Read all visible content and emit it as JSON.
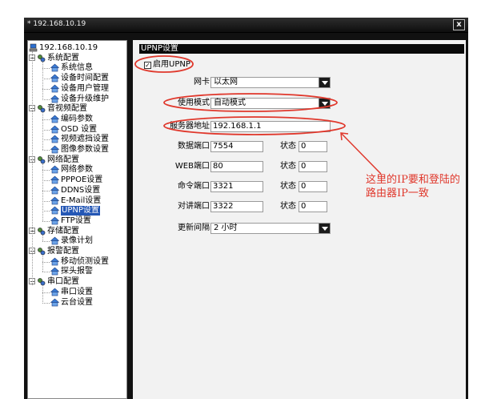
{
  "window": {
    "title": "* 192.168.10.19",
    "close_label": "x"
  },
  "tree": [
    {
      "label": "192.168.10.19",
      "level": 0,
      "icon": "computer-icon"
    },
    {
      "label": "系统配置",
      "level": 1,
      "icon": "folder-config-icon",
      "expand": "−"
    },
    {
      "label": "系统信息",
      "level": 2,
      "icon": "house-icon"
    },
    {
      "label": "设备时间配置",
      "level": 2,
      "icon": "house-icon"
    },
    {
      "label": "设备用户管理",
      "level": 2,
      "icon": "house-icon"
    },
    {
      "label": "设备升级维护",
      "level": 2,
      "icon": "house-icon"
    },
    {
      "label": "音视频配置",
      "level": 1,
      "icon": "folder-config-icon",
      "expand": "−"
    },
    {
      "label": "编码参数",
      "level": 2,
      "icon": "house-icon"
    },
    {
      "label": "OSD 设置",
      "level": 2,
      "icon": "house-icon"
    },
    {
      "label": "视频遮挡设置",
      "level": 2,
      "icon": "house-icon"
    },
    {
      "label": "图像参数设置",
      "level": 2,
      "icon": "house-icon"
    },
    {
      "label": "网络配置",
      "level": 1,
      "icon": "folder-config-icon",
      "expand": "−"
    },
    {
      "label": "网络参数",
      "level": 2,
      "icon": "house-icon"
    },
    {
      "label": "PPPOE设置",
      "level": 2,
      "icon": "house-icon"
    },
    {
      "label": "DDNS设置",
      "level": 2,
      "icon": "house-icon"
    },
    {
      "label": "E-Mail设置",
      "level": 2,
      "icon": "house-icon"
    },
    {
      "label": "UPNP设置",
      "level": 2,
      "icon": "house-icon",
      "selected": true
    },
    {
      "label": "FTP设置",
      "level": 2,
      "icon": "house-icon"
    },
    {
      "label": "存储配置",
      "level": 1,
      "icon": "folder-config-icon",
      "expand": "−"
    },
    {
      "label": "录像计划",
      "level": 2,
      "icon": "house-icon"
    },
    {
      "label": "报警配置",
      "level": 1,
      "icon": "folder-config-icon",
      "expand": "−"
    },
    {
      "label": "移动侦测设置",
      "level": 2,
      "icon": "house-icon"
    },
    {
      "label": "探头报警",
      "level": 2,
      "icon": "house-icon"
    },
    {
      "label": "串口配置",
      "level": 1,
      "icon": "folder-config-icon",
      "expand": "−"
    },
    {
      "label": "串口设置",
      "level": 2,
      "icon": "house-icon"
    },
    {
      "label": "云台设置",
      "level": 2,
      "icon": "house-icon"
    }
  ],
  "panel": {
    "title": "UPNP设置",
    "enable_checkbox": {
      "label": "启用UPNP",
      "checked": true,
      "mark": "✓"
    },
    "nic": {
      "label": "网卡",
      "value": "以太网"
    },
    "mode": {
      "label": "使用模式",
      "value": "自动模式"
    },
    "server": {
      "label": "服务器地址",
      "value": "192.168.1.1"
    },
    "status_label": "状态",
    "ports": [
      {
        "label": "数据端口",
        "value": "7554",
        "status": "0"
      },
      {
        "label": "WEB端口",
        "value": "80",
        "status": "0"
      },
      {
        "label": "命令端口",
        "value": "3321",
        "status": "0"
      },
      {
        "label": "对讲端口",
        "value": "3322",
        "status": "0"
      }
    ],
    "interval": {
      "label": "更新间隔",
      "value": "2 小时"
    }
  },
  "annotation": {
    "text": "这里的IP要和登陆的路由器IP一致",
    "color": "#e0382c"
  }
}
